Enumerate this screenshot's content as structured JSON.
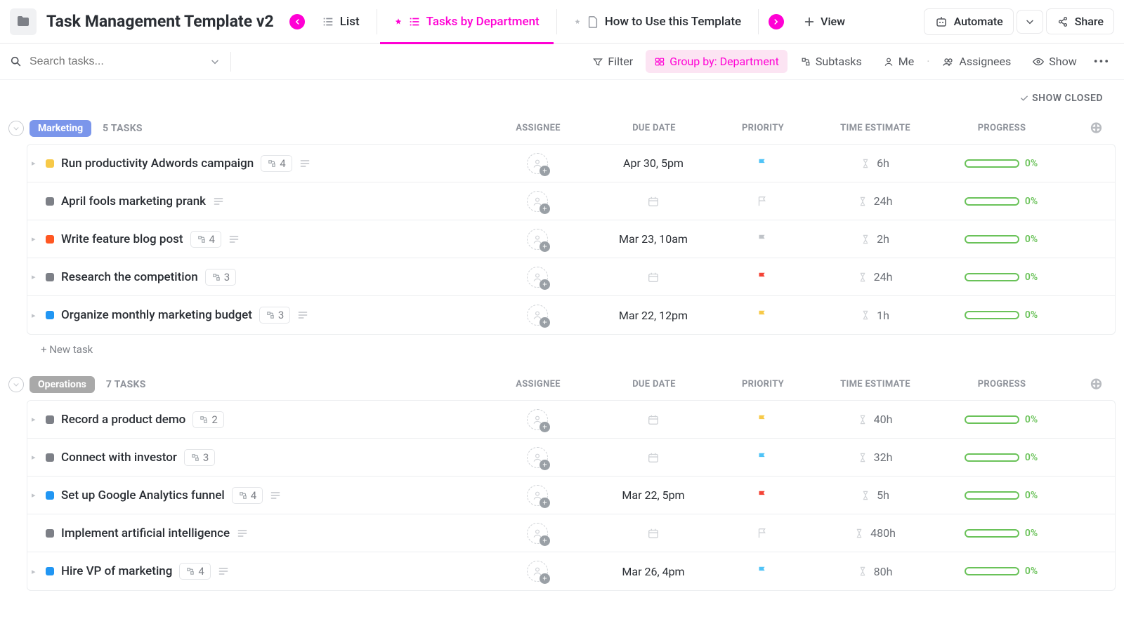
{
  "header": {
    "title": "Task Management Template v2",
    "views": {
      "list": "List",
      "by_dept": "Tasks by Department",
      "howto": "How to Use this Template",
      "add_view": "View"
    },
    "automate": "Automate",
    "share": "Share"
  },
  "toolbar": {
    "search_placeholder": "Search tasks...",
    "filter": "Filter",
    "group_by": "Group by: Department",
    "subtasks": "Subtasks",
    "me": "Me",
    "assignees": "Assignees",
    "show": "Show"
  },
  "show_closed": "SHOW CLOSED",
  "columns": {
    "assignee": "ASSIGNEE",
    "due_date": "DUE DATE",
    "priority": "PRIORITY",
    "time_estimate": "TIME ESTIMATE",
    "progress": "PROGRESS"
  },
  "new_task": "+ New task",
  "groups": [
    {
      "name": "Marketing",
      "count_label": "5 TASKS",
      "tag_class": "marketing",
      "tasks": [
        {
          "name": "Run productivity Adwords campaign",
          "status": "#f7c948",
          "expand": true,
          "subtasks": "4",
          "desc": true,
          "due": "Apr 30, 5pm",
          "flag": "#4fc3f7",
          "flag_style": "solid",
          "estimate": "6h",
          "progress": "0%"
        },
        {
          "name": "April fools marketing prank",
          "status": "#7d8087",
          "expand": false,
          "subtasks": "",
          "desc": true,
          "due": "",
          "flag": "#cfd2d6",
          "flag_style": "outline",
          "estimate": "24h",
          "progress": "0%"
        },
        {
          "name": "Write feature blog post",
          "status": "#ff5722",
          "expand": true,
          "subtasks": "4",
          "desc": true,
          "due": "Mar 23, 10am",
          "flag": "#bfc3c8",
          "flag_style": "solid",
          "estimate": "2h",
          "progress": "0%"
        },
        {
          "name": "Research the competition",
          "status": "#7d8087",
          "expand": true,
          "subtasks": "3",
          "desc": false,
          "due": "",
          "flag": "#f44336",
          "flag_style": "solid",
          "estimate": "24h",
          "progress": "0%"
        },
        {
          "name": "Organize monthly marketing budget",
          "status": "#2196f3",
          "expand": true,
          "subtasks": "3",
          "desc": true,
          "due": "Mar 22, 12pm",
          "flag": "#f7c948",
          "flag_style": "solid",
          "estimate": "1h",
          "progress": "0%"
        }
      ]
    },
    {
      "name": "Operations",
      "count_label": "7 TASKS",
      "tag_class": "operations",
      "tasks": [
        {
          "name": "Record a product demo",
          "status": "#7d8087",
          "expand": true,
          "subtasks": "2",
          "desc": false,
          "due": "",
          "flag": "#f7c948",
          "flag_style": "solid",
          "estimate": "40h",
          "progress": "0%"
        },
        {
          "name": "Connect with investor",
          "status": "#7d8087",
          "expand": true,
          "subtasks": "3",
          "desc": false,
          "due": "",
          "flag": "#4fc3f7",
          "flag_style": "solid",
          "estimate": "32h",
          "progress": "0%"
        },
        {
          "name": "Set up Google Analytics funnel",
          "status": "#2196f3",
          "expand": true,
          "subtasks": "4",
          "desc": true,
          "due": "Mar 22, 5pm",
          "flag": "#f44336",
          "flag_style": "solid",
          "estimate": "5h",
          "progress": "0%"
        },
        {
          "name": "Implement artificial intelligence",
          "status": "#7d8087",
          "expand": false,
          "subtasks": "",
          "desc": true,
          "due": "",
          "flag": "#cfd2d6",
          "flag_style": "outline",
          "estimate": "480h",
          "progress": "0%"
        },
        {
          "name": "Hire VP of marketing",
          "status": "#2196f3",
          "expand": true,
          "subtasks": "4",
          "desc": true,
          "due": "Mar 26, 4pm",
          "flag": "#4fc3f7",
          "flag_style": "solid",
          "estimate": "80h",
          "progress": "0%"
        }
      ]
    }
  ]
}
